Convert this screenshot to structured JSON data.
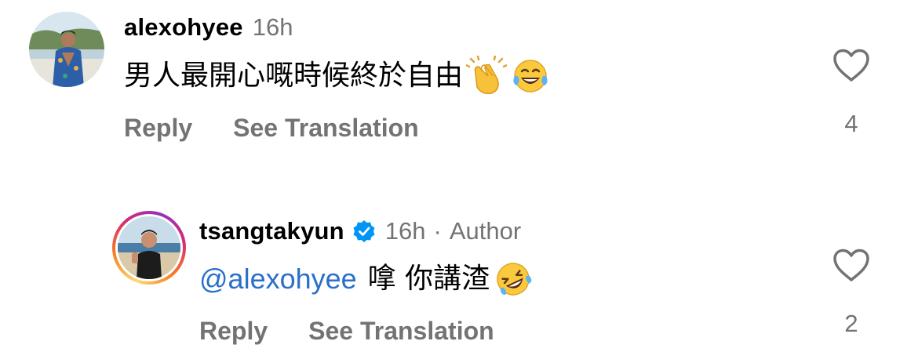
{
  "comments": [
    {
      "username": "alexohyee",
      "time": "16h",
      "text": "男人最開心嘅時候終於自由",
      "emojis": [
        "clapping-hands-emoji",
        "tears-of-joy-emoji"
      ],
      "reply_label": "Reply",
      "translate_label": "See Translation",
      "like_count": "4"
    },
    {
      "username": "tsangtakyun",
      "verified": true,
      "time": "16h",
      "separator": "·",
      "author_label": "Author",
      "mention": "@alexohyee",
      "text": "嗱 你講渣",
      "emojis": [
        "rolling-on-floor-laughing-emoji"
      ],
      "reply_label": "Reply",
      "translate_label": "See Translation",
      "like_count": "2"
    }
  ],
  "colors": {
    "secondary_text": "#737373",
    "mention": "#2a6fc9",
    "verified_badge": "#0095f6"
  }
}
